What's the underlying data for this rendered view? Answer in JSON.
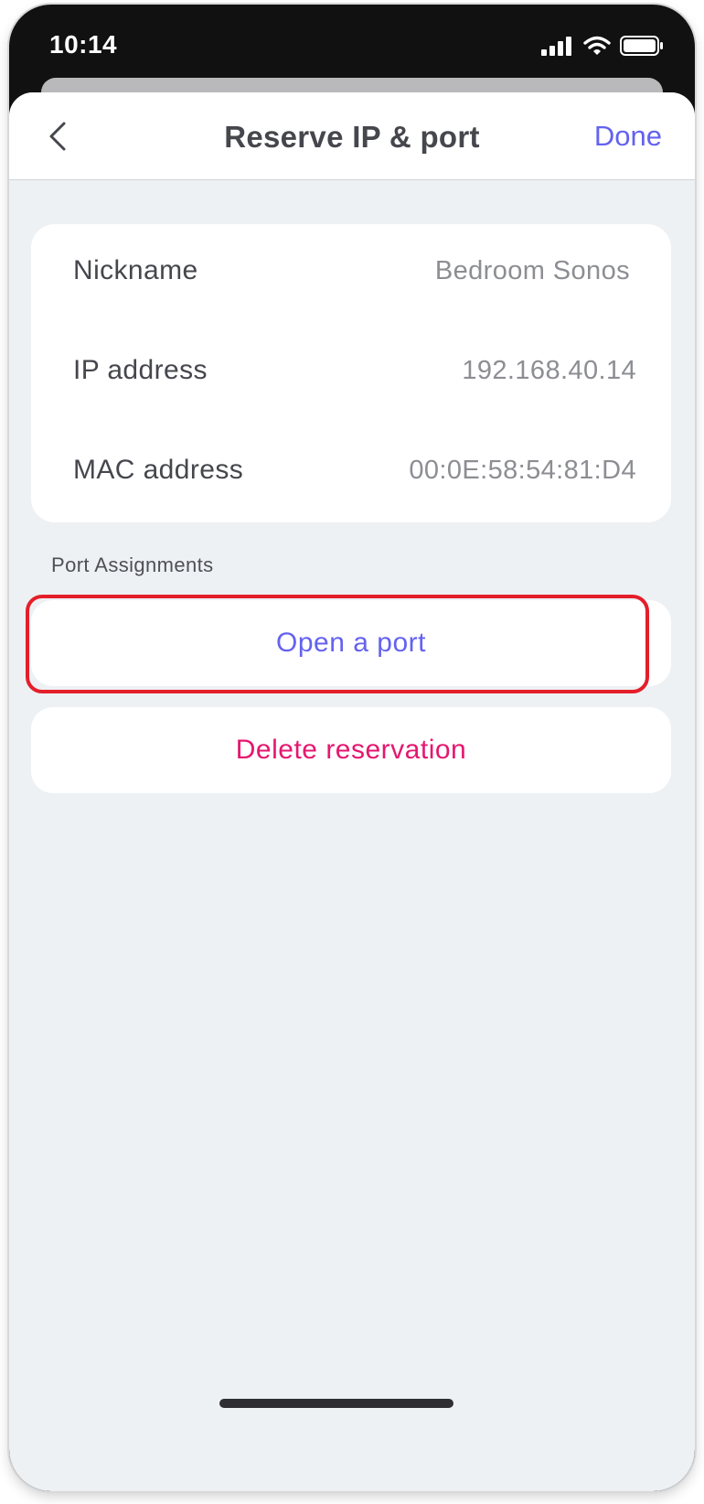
{
  "status_bar": {
    "time": "10:14",
    "icons": [
      "signal-icon",
      "wifi-icon",
      "battery-icon"
    ]
  },
  "nav": {
    "back_icon": "chevron-left-icon",
    "title": "Reserve IP & port",
    "done_label": "Done"
  },
  "reservation": {
    "rows": [
      {
        "label": "Nickname",
        "value": "Bedroom Sonos"
      },
      {
        "label": "IP address",
        "value": "192.168.40.14"
      },
      {
        "label": "MAC address",
        "value": "00:0E:58:54:81:D4"
      }
    ]
  },
  "port_assignments": {
    "section_label": "Port Assignments",
    "open_port_label": "Open a port"
  },
  "delete_label": "Delete reservation",
  "colors": {
    "accent": "#6462ef",
    "destructive": "#e5176f",
    "highlight": "#e41f2a",
    "background": "#eef1f4"
  }
}
